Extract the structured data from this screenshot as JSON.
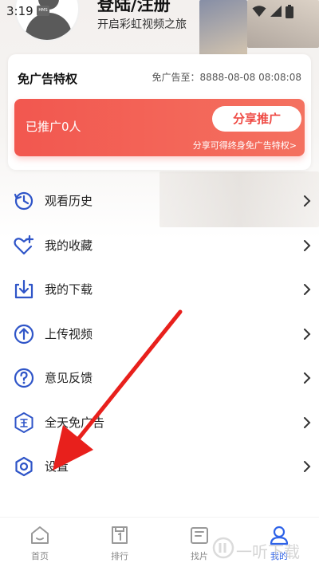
{
  "status_bar": {
    "time": "3:19",
    "badge": "HMS"
  },
  "header": {
    "login_title": "登陆/注册",
    "subtitle": "开启彩虹视频之旅"
  },
  "ad_card": {
    "title": "免广告特权",
    "expiry": "免广告至：8888-08-08 08:08:08",
    "promoted_count": "已推广0人",
    "share_button": "分享推广",
    "hint": "分享可得终身免广告特权>"
  },
  "menu": {
    "items": [
      {
        "label": "观看历史",
        "icon": "history-icon"
      },
      {
        "label": "我的收藏",
        "icon": "heart-plus-icon"
      },
      {
        "label": "我的下载",
        "icon": "download-icon"
      },
      {
        "label": "上传视频",
        "icon": "upload-icon"
      },
      {
        "label": "意见反馈",
        "icon": "question-icon"
      },
      {
        "label": "全天免广告",
        "icon": "ad-free-icon"
      },
      {
        "label": "设置",
        "icon": "settings-icon"
      }
    ]
  },
  "bottom_nav": {
    "items": [
      {
        "label": "首页",
        "icon": "home-icon",
        "active": false
      },
      {
        "label": "排行",
        "icon": "ranking-icon",
        "active": false
      },
      {
        "label": "找片",
        "icon": "find-icon",
        "active": false
      },
      {
        "label": "我的",
        "icon": "profile-icon",
        "active": true
      }
    ]
  },
  "watermark": "一听下载",
  "colors": {
    "accent": "#2f63e8",
    "promo_red": "#f2574f",
    "arrow_red": "#e8201c",
    "icon_blue": "#2f55c8"
  }
}
